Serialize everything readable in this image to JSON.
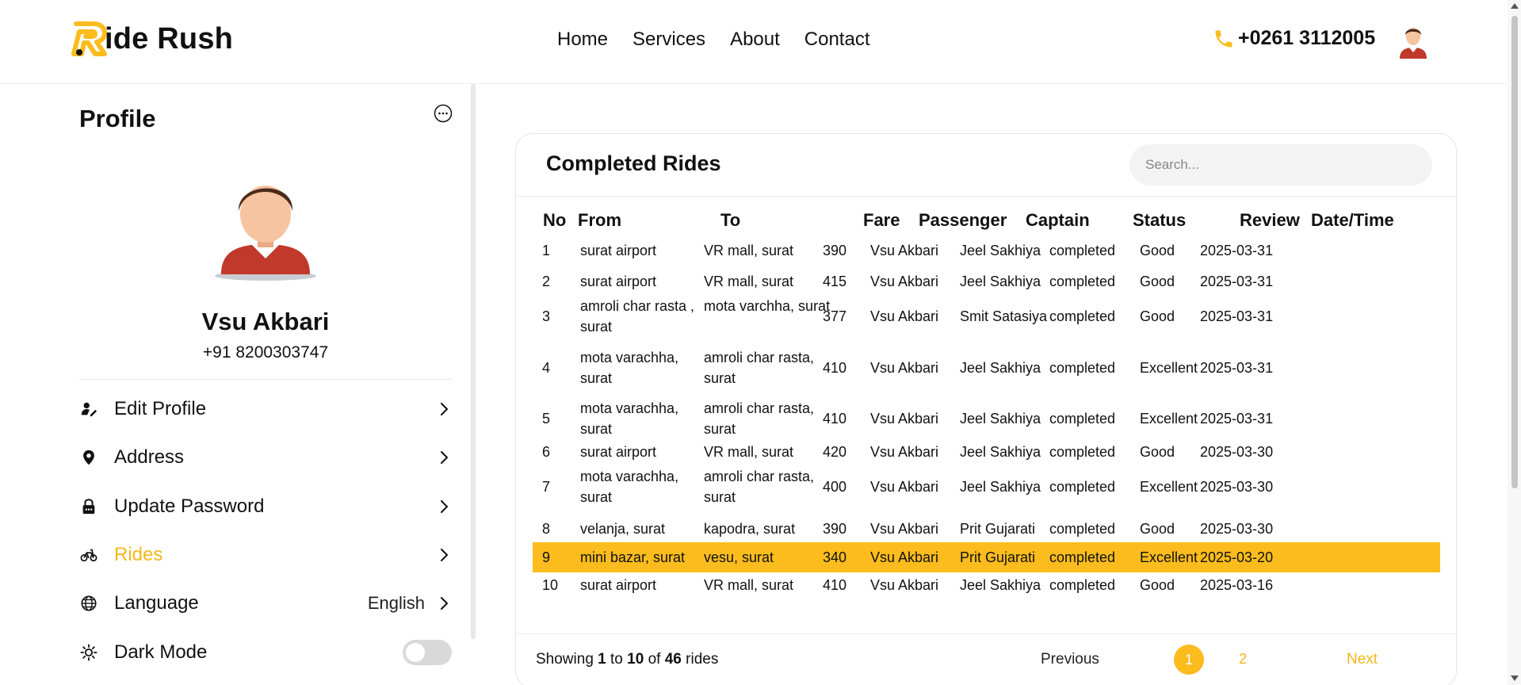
{
  "brand": {
    "name": "ide Rush",
    "accent": "#fcbc1e",
    "accent_text": "#f6b71e"
  },
  "nav": [
    {
      "label": "Home"
    },
    {
      "label": "Services"
    },
    {
      "label": "About"
    },
    {
      "label": "Contact"
    }
  ],
  "header": {
    "phone": "+0261 3112005"
  },
  "sidebar": {
    "title": "Profile",
    "name": "Vsu Akbari",
    "phone": "+91 8200303747",
    "menu": [
      {
        "label": "Edit Profile",
        "icon": "user-edit-icon"
      },
      {
        "label": "Address",
        "icon": "location-pin-icon"
      },
      {
        "label": "Update Password",
        "icon": "lock-icon"
      },
      {
        "label": "Rides",
        "icon": "bike-icon",
        "active": true
      },
      {
        "label": "Language",
        "icon": "globe-icon",
        "value": "English"
      },
      {
        "label": "Dark Mode",
        "icon": "sun-icon",
        "toggle": false
      }
    ]
  },
  "rides": {
    "title": "Completed Rides",
    "search_placeholder": "Search...",
    "columns": [
      "No",
      "From",
      "To",
      "Fare",
      "Passenger",
      "Captain",
      "Status",
      "Review",
      "Date/Time"
    ],
    "rows": [
      {
        "no": "1",
        "from": "surat airport",
        "to": "VR mall, surat",
        "fare": "390",
        "passenger": "Vsu Akbari",
        "captain": "Jeel Sakhiya",
        "status": "completed",
        "review": "Good",
        "date": "2025-03-31"
      },
      {
        "no": "2",
        "from": "surat airport",
        "to": "VR mall, surat",
        "fare": "415",
        "passenger": "Vsu Akbari",
        "captain": "Jeel Sakhiya",
        "status": "completed",
        "review": "Good",
        "date": "2025-03-31"
      },
      {
        "no": "3",
        "from": "amroli char rasta , surat",
        "to": "mota varchha, surat",
        "fare": "377",
        "passenger": "Vsu Akbari",
        "captain": "Smit Satasiya",
        "status": "completed",
        "review": "Good",
        "date": "2025-03-31"
      },
      {
        "no": "4",
        "from": "mota varachha, surat",
        "to": "amroli char rasta, surat",
        "fare": "410",
        "passenger": "Vsu Akbari",
        "captain": "Jeel Sakhiya",
        "status": "completed",
        "review": "Excellent",
        "date": "2025-03-31"
      },
      {
        "no": "5",
        "from": "mota varachha, surat",
        "to": "amroli char rasta, surat",
        "fare": "410",
        "passenger": "Vsu Akbari",
        "captain": "Jeel Sakhiya",
        "status": "completed",
        "review": "Excellent",
        "date": "2025-03-31"
      },
      {
        "no": "6",
        "from": "surat airport",
        "to": "VR mall, surat",
        "fare": "420",
        "passenger": "Vsu Akbari",
        "captain": "Jeel Sakhiya",
        "status": "completed",
        "review": "Good",
        "date": "2025-03-30"
      },
      {
        "no": "7",
        "from": "mota varachha, surat",
        "to": "amroli char rasta, surat",
        "fare": "400",
        "passenger": "Vsu Akbari",
        "captain": "Jeel Sakhiya",
        "status": "completed",
        "review": "Excellent",
        "date": "2025-03-30"
      },
      {
        "no": "8",
        "from": "velanja, surat",
        "to": "kapodra, surat",
        "fare": "390",
        "passenger": "Vsu Akbari",
        "captain": "Prit Gujarati",
        "status": "completed",
        "review": "Good",
        "date": "2025-03-30"
      },
      {
        "no": "9",
        "from": "mini bazar, surat",
        "to": "vesu, surat",
        "fare": "340",
        "passenger": "Vsu Akbari",
        "captain": "Prit Gujarati",
        "status": "completed",
        "review": "Excellent",
        "date": "2025-03-20",
        "highlighted": true
      },
      {
        "no": "10",
        "from": "surat airport",
        "to": "VR mall, surat",
        "fare": "410",
        "passenger": "Vsu Akbari",
        "captain": "Jeel Sakhiya",
        "status": "completed",
        "review": "Good",
        "date": "2025-03-16"
      }
    ],
    "footer": {
      "showing_prefix": "Showing",
      "from": "1",
      "to_word": "to",
      "to": "10",
      "of_word": "of",
      "total": "46",
      "suffix": "rides",
      "previous": "Previous",
      "pages": [
        "1",
        "2"
      ],
      "current_page": "1",
      "next": "Next"
    }
  }
}
